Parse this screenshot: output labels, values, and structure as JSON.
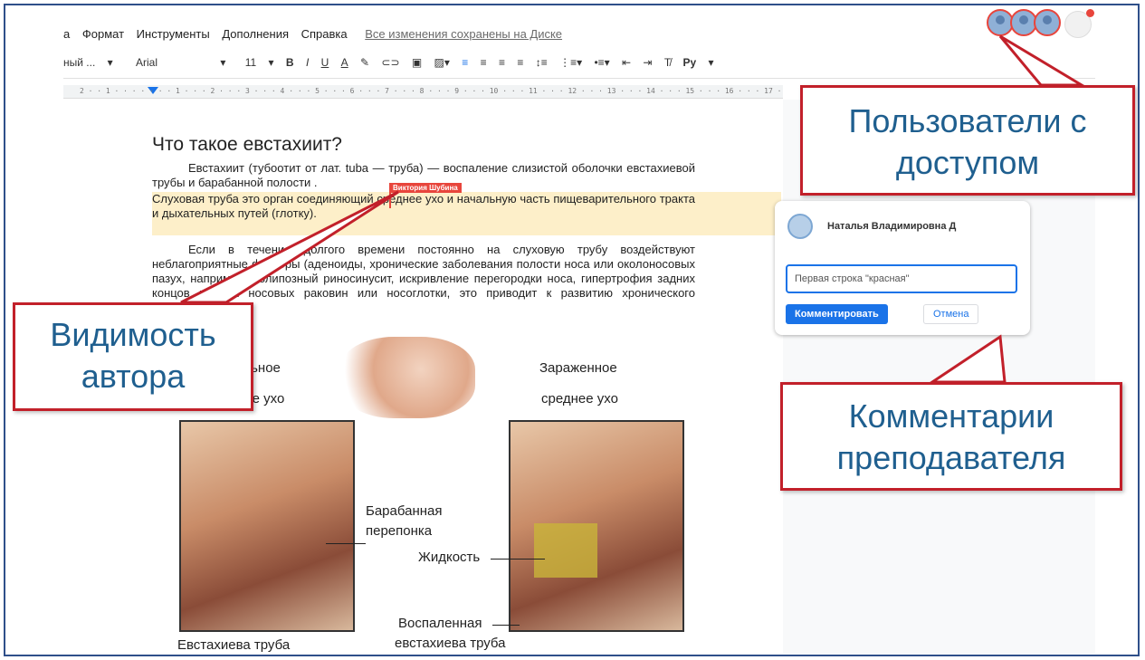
{
  "menu": {
    "items": [
      "а",
      "Формат",
      "Инструменты",
      "Дополнения",
      "Справка"
    ],
    "saved_status": "Все изменения сохранены на Диске"
  },
  "toolbar": {
    "style": "ный ...",
    "font": "Arial",
    "size": "11",
    "bold": "B",
    "italic": "I",
    "underline": "U",
    "text_color": "A",
    "language": "Ру"
  },
  "ruler": {
    "ticks": "2 · · 1 · · · · · · · 1 · · · 2 · · · 3 · · · 4 · · · 5 · · · 6 · · · 7 · · · 8 · · · 9 · · · 10 · · · 11 · · · 12 · · · 13 · · · 14 · · · 15 · · · 16 · · · 17 · · · 18"
  },
  "document": {
    "heading": "Что такое евстахиит?",
    "p1": "Евстахиит (тубоотит от лат. tuba — труба) — воспаление слизистой оболочки евстахиевой трубы и барабанной полости .",
    "p2": "Слуховая труба это орган соединяющий среднее ухо и начальную часть пищеварительного тракта и дыхательных путей (глотку).",
    "p3": "Если в течение долгого времени постоянно на слуховую трубу воздействуют неблагоприятные факторы (аденоиды, хронические заболевания полости носа или околоносовых пазух, например, полипозный риносинусит, искривление перегородки носа, гипертрофия задних концов нижних носовых раковин или носоглотки, это приводит к развитию хронического тубоотита.",
    "author_tag": "Виктория Шубина"
  },
  "figure": {
    "left_title_1": "альное",
    "left_title_2": "нее ухо",
    "right_title_1": "Зараженное",
    "right_title_2": "среднее ухо",
    "label_drum_1": "Барабанная",
    "label_drum_2": "перепонка",
    "label_fluid": "Жидкость",
    "label_inflamed_1": "Воспаленная",
    "label_inflamed_2": "евстахиева труба",
    "label_tube": "Евстахиева труба"
  },
  "comment": {
    "author": "Наталья Владимировна Д",
    "input_value": "Первая строка \"красная\"",
    "comment_button": "Комментировать",
    "cancel_button": "Отмена"
  },
  "callouts": {
    "users_1": "Пользователи с",
    "users_2": "доступом",
    "author_1": "Видимость",
    "author_2": "автора",
    "comments_1": "Комментарии",
    "comments_2": "преподавателя"
  },
  "colors": {
    "callout_border": "#c2202a",
    "callout_text": "#1f5f8f",
    "accent": "#1a73e8",
    "highlight": "#fde293"
  }
}
